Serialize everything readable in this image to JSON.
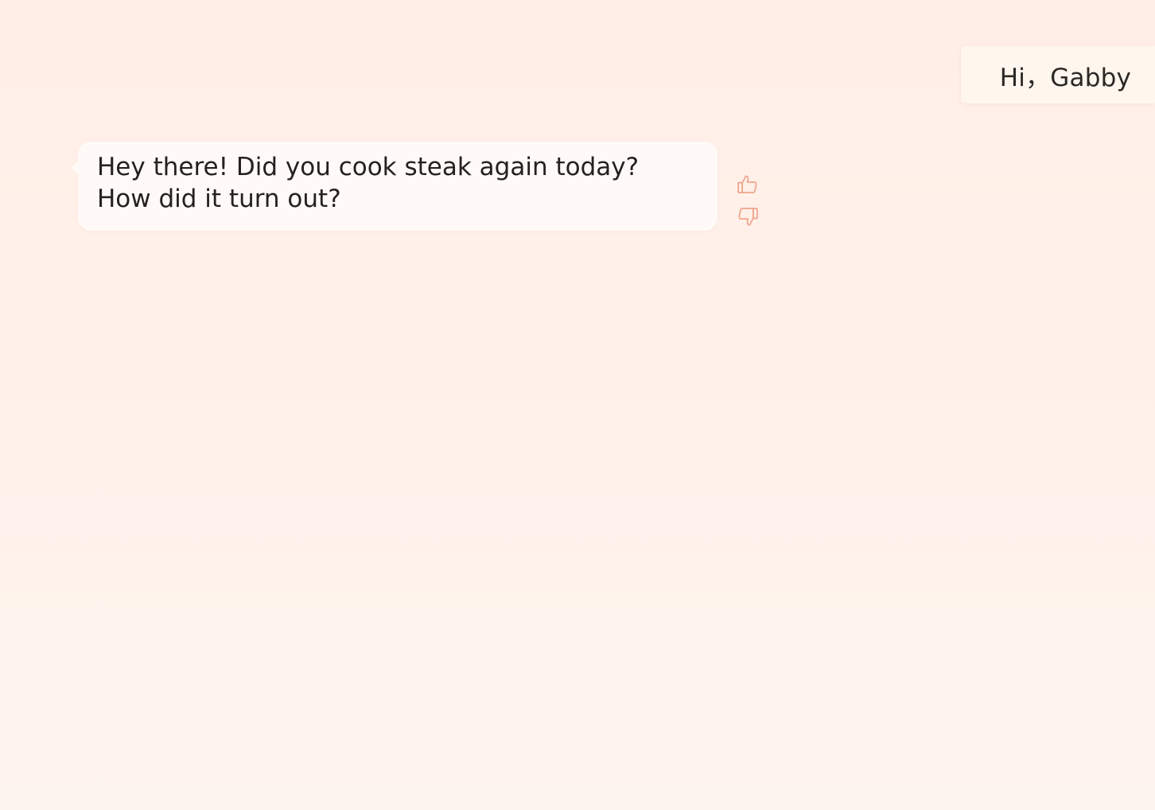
{
  "header": {
    "greeting": "Hi，Gabby"
  },
  "chat": {
    "messages": [
      {
        "role": "assistant",
        "text": "Hey there! Did you cook steak again today? How did it turn out?"
      }
    ],
    "feedback": {
      "like_icon": "thumbs-up-icon",
      "dislike_icon": "thumbs-down-icon"
    }
  },
  "colors": {
    "accent": "#f1a48d",
    "bubble_bg": "#fffaf7",
    "greeting_bg": "#fff6ee",
    "page_bg_top": "#ffeee7",
    "page_bg_bottom": "#fff5ef"
  }
}
